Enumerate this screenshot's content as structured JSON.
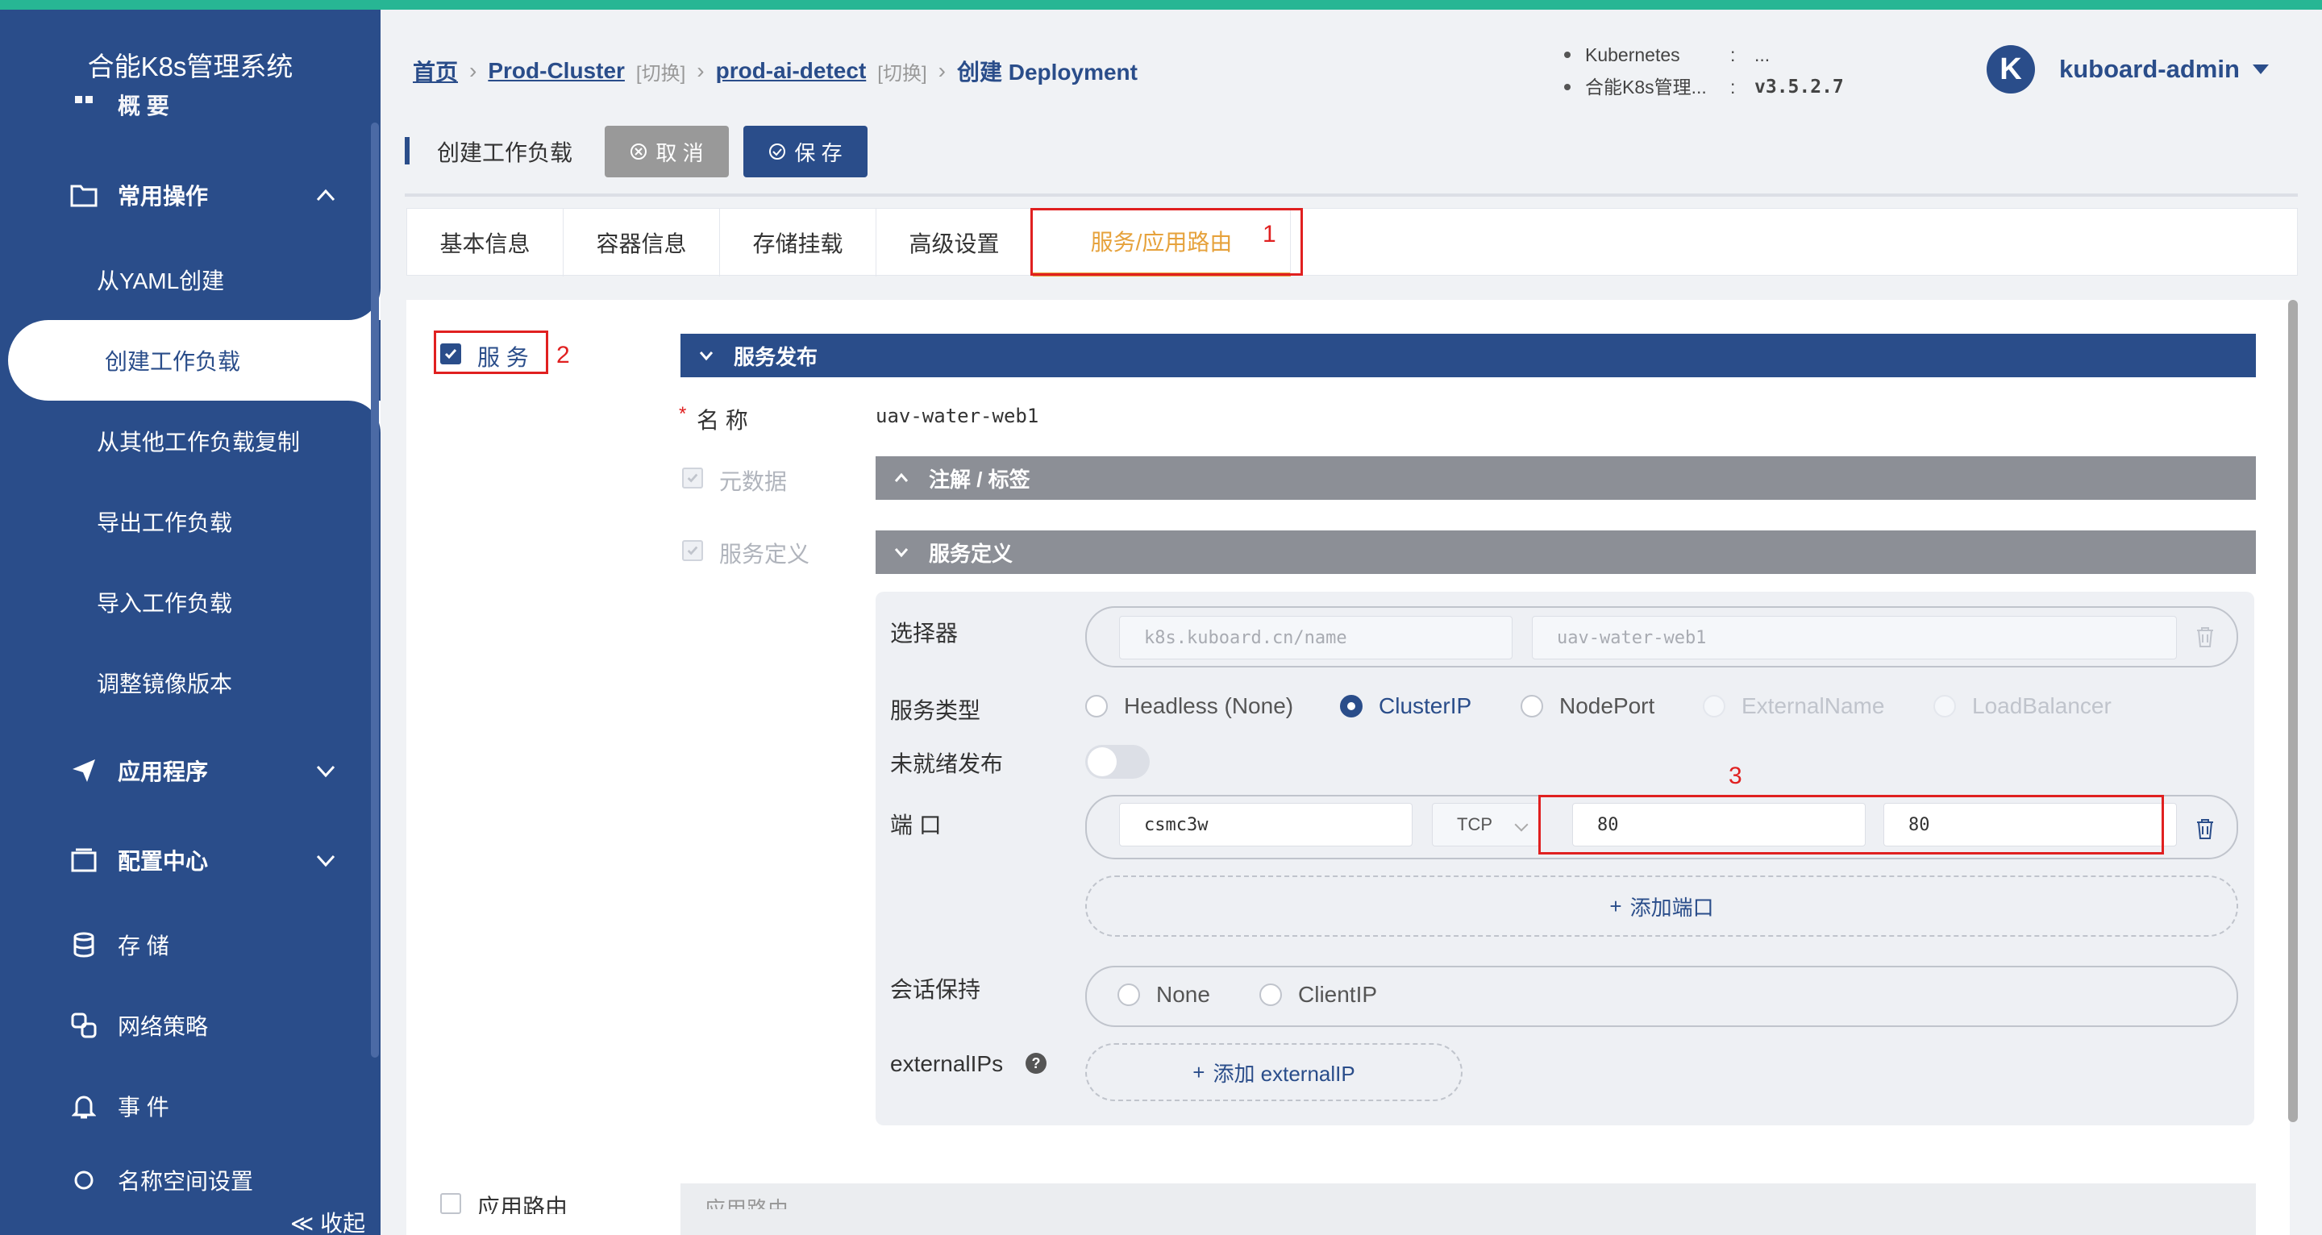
{
  "sidebar": {
    "title": "合能K8s管理系统",
    "partial_top": "概 要",
    "common_ops": "常用操作",
    "sub_items": [
      "从YAML创建",
      "创建工作负载",
      "从其他工作负载复制",
      "导出工作负载",
      "导入工作负载",
      "调整镜像版本"
    ],
    "apps": "应用程序",
    "config": "配置中心",
    "storage": "存 储",
    "netpolicy": "网络策略",
    "events": "事 件",
    "partial_bottom": "名称空间设置",
    "collapse": "≪ 收起"
  },
  "breadcrumb": {
    "home": "首页",
    "cluster": "Prod-Cluster",
    "switch1": "[切换]",
    "namespace": "prod-ai-detect",
    "switch2": "[切换]",
    "current": "创建 Deployment"
  },
  "kinfo": {
    "row1_label": "Kubernetes",
    "row1_colon": ":",
    "row1_value": "...",
    "row2_label": "合能K8s管理...",
    "row2_colon": ":",
    "row2_value": "v3.5.2.7"
  },
  "user": {
    "initial": "K",
    "name": "kuboard-admin"
  },
  "toolbar": {
    "title": "创建工作负载",
    "cancel": "取 消",
    "save": "保 存"
  },
  "tabs": [
    "基本信息",
    "容器信息",
    "存储挂载",
    "高级设置",
    "服务/应用路由"
  ],
  "annotations": {
    "n1": "1",
    "n2": "2",
    "n3": "3"
  },
  "service": {
    "checkbox_label": "服 务",
    "publish_title": "服务发布",
    "name_star": "*",
    "name_label": "名 称",
    "name_value": "uav-water-web1",
    "meta_label": "元数据",
    "meta_section": "注解 / 标签",
    "def_label": "服务定义",
    "def_section": "服务定义",
    "selector_label": "选择器",
    "selector_key": "k8s.kuboard.cn/name",
    "selector_value": "uav-water-web1",
    "type_label": "服务类型",
    "types": [
      "Headless (None)",
      "ClusterIP",
      "NodePort",
      "ExternalName",
      "LoadBalancer"
    ],
    "selected_type": "ClusterIP",
    "unready_label": "未就绪发布",
    "port_label": "端 口",
    "port_name": "csmc3w",
    "protocol": "TCP",
    "port": "80",
    "target_port": "80",
    "add_port": "添加端口",
    "session_label": "会话保持",
    "session_options": [
      "None",
      "ClientIP"
    ],
    "externalips_label": "externalIPs",
    "help": "?",
    "add_externalip": "添加 externalIP"
  },
  "ingress": {
    "checkbox_label": "应用路由",
    "section": "应用路由"
  }
}
